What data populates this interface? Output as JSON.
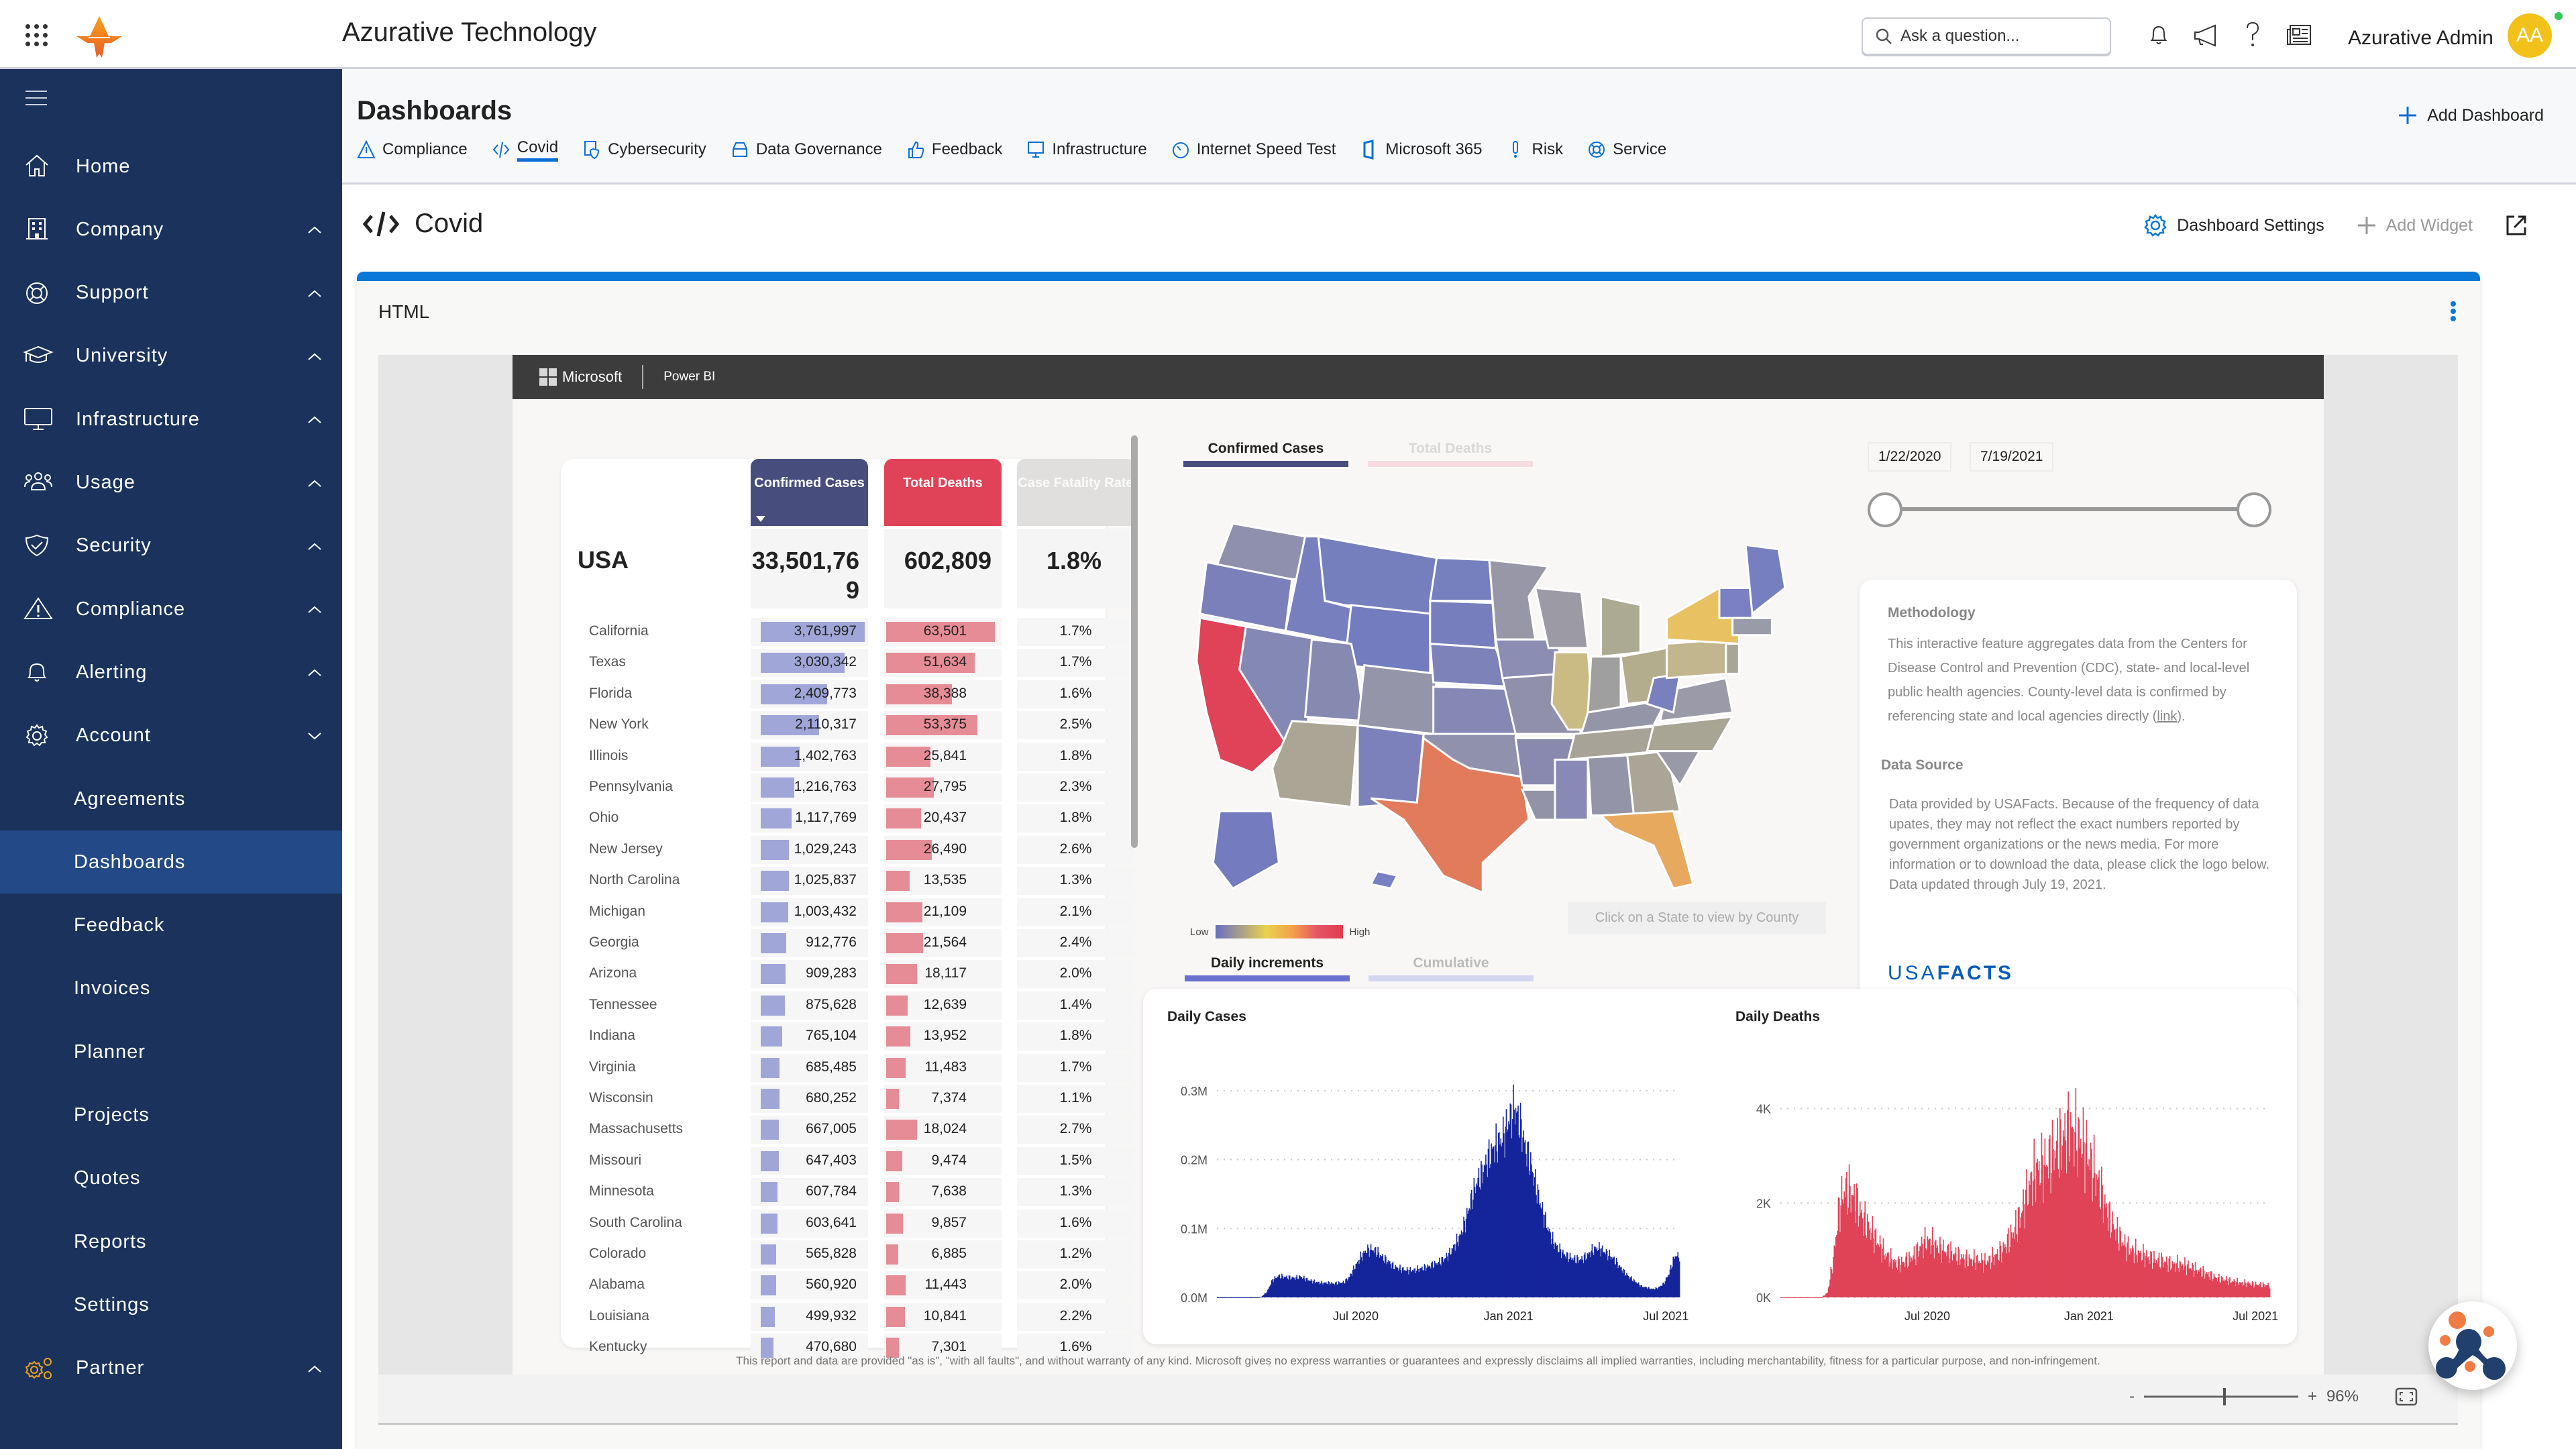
{
  "app": {
    "title": "Azurative Technology",
    "search_placeholder": "Ask a question...",
    "user_name": "Azurative Admin",
    "user_initials": "AA"
  },
  "sidebar": {
    "items": [
      {
        "label": "Home",
        "icon": "home-icon",
        "chevron": ""
      },
      {
        "label": "Company",
        "icon": "building-icon",
        "chevron": "up"
      },
      {
        "label": "Support",
        "icon": "lifebuoy-icon",
        "chevron": "up"
      },
      {
        "label": "University",
        "icon": "graduation-cap-icon",
        "chevron": "up"
      },
      {
        "label": "Infrastructure",
        "icon": "monitor-icon",
        "chevron": "up"
      },
      {
        "label": "Usage",
        "icon": "people-icon",
        "chevron": "up"
      },
      {
        "label": "Security",
        "icon": "shield-check-icon",
        "chevron": "up"
      },
      {
        "label": "Compliance",
        "icon": "warning-icon",
        "chevron": "up"
      },
      {
        "label": "Alerting",
        "icon": "bell-icon",
        "chevron": "up"
      },
      {
        "label": "Account",
        "icon": "gear-icon",
        "chevron": "down"
      }
    ],
    "sub_items": [
      "Agreements",
      "Dashboards",
      "Feedback",
      "Invoices",
      "Planner",
      "Projects",
      "Quotes",
      "Reports",
      "Settings"
    ],
    "active_sub": "Dashboards",
    "partner": {
      "label": "Partner",
      "icon": "gears-icon",
      "chevron": "up"
    }
  },
  "dashboards": {
    "title": "Dashboards",
    "add_label": "Add Dashboard",
    "tabs": [
      {
        "label": "Compliance",
        "icon": "warning-icon"
      },
      {
        "label": "Covid",
        "icon": "code-icon",
        "active": true
      },
      {
        "label": "Cybersecurity",
        "icon": "shield-doc-icon"
      },
      {
        "label": "Data Governance",
        "icon": "drive-icon"
      },
      {
        "label": "Feedback",
        "icon": "thumbs-up-icon"
      },
      {
        "label": "Infrastructure",
        "icon": "monitor-icon"
      },
      {
        "label": "Internet Speed Test",
        "icon": "speedometer-icon"
      },
      {
        "label": "Microsoft 365",
        "icon": "office-icon"
      },
      {
        "label": "Risk",
        "icon": "exclamation-icon"
      },
      {
        "label": "Service",
        "icon": "lifebuoy-icon"
      }
    ]
  },
  "page": {
    "title": "Covid",
    "settings_label": "Dashboard Settings",
    "add_widget_label": "Add Widget",
    "widget_title": "HTML"
  },
  "powerbi": {
    "brand": "Microsoft",
    "product": "Power BI",
    "headers": {
      "confirmed": "Confirmed Cases",
      "deaths": "Total Deaths",
      "cfr": "Case Fatality Rate"
    },
    "usa": {
      "label": "USA",
      "confirmed": "33,501,769",
      "deaths": "602,809",
      "cfr": "1.8%"
    },
    "states": [
      {
        "name": "California",
        "confirmed": "3,761,997",
        "deaths": "63,501",
        "cfr": "1.7%",
        "c": 3761997,
        "d": 63501
      },
      {
        "name": "Texas",
        "confirmed": "3,030,342",
        "deaths": "51,634",
        "cfr": "1.7%",
        "c": 3030342,
        "d": 51634
      },
      {
        "name": "Florida",
        "confirmed": "2,409,773",
        "deaths": "38,388",
        "cfr": "1.6%",
        "c": 2409773,
        "d": 38388
      },
      {
        "name": "New York",
        "confirmed": "2,110,317",
        "deaths": "53,375",
        "cfr": "2.5%",
        "c": 2110317,
        "d": 53375
      },
      {
        "name": "Illinois",
        "confirmed": "1,402,763",
        "deaths": "25,841",
        "cfr": "1.8%",
        "c": 1402763,
        "d": 25841
      },
      {
        "name": "Pennsylvania",
        "confirmed": "1,216,763",
        "deaths": "27,795",
        "cfr": "2.3%",
        "c": 1216763,
        "d": 27795
      },
      {
        "name": "Ohio",
        "confirmed": "1,117,769",
        "deaths": "20,437",
        "cfr": "1.8%",
        "c": 1117769,
        "d": 20437
      },
      {
        "name": "New Jersey",
        "confirmed": "1,029,243",
        "deaths": "26,490",
        "cfr": "2.6%",
        "c": 1029243,
        "d": 26490
      },
      {
        "name": "North Carolina",
        "confirmed": "1,025,837",
        "deaths": "13,535",
        "cfr": "1.3%",
        "c": 1025837,
        "d": 13535
      },
      {
        "name": "Michigan",
        "confirmed": "1,003,432",
        "deaths": "21,109",
        "cfr": "2.1%",
        "c": 1003432,
        "d": 21109
      },
      {
        "name": "Georgia",
        "confirmed": "912,776",
        "deaths": "21,564",
        "cfr": "2.4%",
        "c": 912776,
        "d": 21564
      },
      {
        "name": "Arizona",
        "confirmed": "909,283",
        "deaths": "18,117",
        "cfr": "2.0%",
        "c": 909283,
        "d": 18117
      },
      {
        "name": "Tennessee",
        "confirmed": "875,628",
        "deaths": "12,639",
        "cfr": "1.4%",
        "c": 875628,
        "d": 12639
      },
      {
        "name": "Indiana",
        "confirmed": "765,104",
        "deaths": "13,952",
        "cfr": "1.8%",
        "c": 765104,
        "d": 13952
      },
      {
        "name": "Virginia",
        "confirmed": "685,485",
        "deaths": "11,483",
        "cfr": "1.7%",
        "c": 685485,
        "d": 11483
      },
      {
        "name": "Wisconsin",
        "confirmed": "680,252",
        "deaths": "7,374",
        "cfr": "1.1%",
        "c": 680252,
        "d": 7374
      },
      {
        "name": "Massachusetts",
        "confirmed": "667,005",
        "deaths": "18,024",
        "cfr": "2.7%",
        "c": 667005,
        "d": 18024
      },
      {
        "name": "Missouri",
        "confirmed": "647,403",
        "deaths": "9,474",
        "cfr": "1.5%",
        "c": 647403,
        "d": 9474
      },
      {
        "name": "Minnesota",
        "confirmed": "607,784",
        "deaths": "7,638",
        "cfr": "1.3%",
        "c": 607784,
        "d": 7638
      },
      {
        "name": "South Carolina",
        "confirmed": "603,641",
        "deaths": "9,857",
        "cfr": "1.6%",
        "c": 603641,
        "d": 9857
      },
      {
        "name": "Colorado",
        "confirmed": "565,828",
        "deaths": "6,885",
        "cfr": "1.2%",
        "c": 565828,
        "d": 6885
      },
      {
        "name": "Alabama",
        "confirmed": "560,920",
        "deaths": "11,443",
        "cfr": "2.0%",
        "c": 560920,
        "d": 11443
      },
      {
        "name": "Louisiana",
        "confirmed": "499,932",
        "deaths": "10,841",
        "cfr": "2.2%",
        "c": 499932,
        "d": 10841
      },
      {
        "name": "Kentucky",
        "confirmed": "470,680",
        "deaths": "7,301",
        "cfr": "1.6%",
        "c": 470680,
        "d": 7301
      }
    ],
    "map_tabs": [
      "Confirmed Cases",
      "Total Deaths"
    ],
    "legend": {
      "low": "Low",
      "high": "High"
    },
    "click_hint": "Click on a State to view by County",
    "date_start": "1/22/2020",
    "date_end": "7/19/2021",
    "methodology_title": "Methodology",
    "methodology_text": "This interactive feature aggregates data from the Centers for Disease Control and Prevention (CDC), state- and local-level public health agencies. County-level data is confirmed by referencing state and local agencies directly (",
    "methodology_link": "link",
    "methodology_end": ").",
    "source_title": "Data Source",
    "source_text": "Data provided by USAFacts. Because of the frequency of data upates, they may not reflect the exact numbers reported by government organizations or the news media. For more information or to download the data, please click the logo below. Data updated through July 19, 2021.",
    "usafacts_a": "USA",
    "usafacts_b": "FACTS",
    "chart_tabs": [
      "Daily increments",
      "Cumulative"
    ],
    "disclaimer": "This report and data are provided \"as is\", \"with all faults\", and without warranty of any kind. Microsoft gives no express warranties or guarantees and expressly disclaims all implied warranties, including merchantability, fitness for a particular purpose, and non-infringement.",
    "zoom_level": "96%"
  },
  "colors": {
    "sidebar": "#1a325c",
    "accent": "#0a78d6",
    "cases": "#14249b",
    "deaths": "#e04257"
  },
  "chart_data": [
    {
      "type": "bar",
      "title": "Daily Cases",
      "xlabel": "",
      "ylabel": "",
      "x_ticks": [
        "Jul 2020",
        "Jan 2021",
        "Jul 2021"
      ],
      "y_ticks": [
        "0.0M",
        "0.1M",
        "0.2M",
        "0.3M"
      ],
      "ylim": [
        0,
        370000
      ],
      "x_range": [
        "2020-01-22",
        "2021-07-19"
      ],
      "series": [
        {
          "name": "Daily Cases",
          "color": "#14249b",
          "weekly_values": [
            0,
            0,
            0,
            0,
            0,
            0,
            0,
            0,
            1000,
            8000,
            25000,
            31000,
            30000,
            29000,
            28000,
            30000,
            27000,
            24000,
            22000,
            21000,
            21000,
            20000,
            21000,
            22000,
            30000,
            45000,
            58000,
            68000,
            70000,
            66000,
            58000,
            52000,
            45000,
            42000,
            40000,
            39000,
            40000,
            42000,
            44000,
            47000,
            50000,
            55000,
            62000,
            75000,
            88000,
            110000,
            140000,
            165000,
            180000,
            200000,
            215000,
            225000,
            235000,
            260000,
            275000,
            250000,
            215000,
            190000,
            155000,
            125000,
            100000,
            80000,
            70000,
            62000,
            58000,
            55000,
            55000,
            60000,
            68000,
            72000,
            68000,
            62000,
            55000,
            45000,
            35000,
            28000,
            22000,
            16000,
            14000,
            12000,
            14000,
            20000,
            35000,
            60000
          ]
        }
      ]
    },
    {
      "type": "bar",
      "title": "Daily Deaths",
      "xlabel": "",
      "ylabel": "",
      "x_ticks": [
        "Jul 2020",
        "Jan 2021",
        "Jul 2021"
      ],
      "y_ticks": [
        "0K",
        "2K",
        "4K"
      ],
      "ylim": [
        0,
        5400
      ],
      "x_range": [
        "2020-01-22",
        "2021-07-19"
      ],
      "series": [
        {
          "name": "Daily Deaths",
          "color": "#e04257",
          "weekly_values": [
            0,
            0,
            0,
            0,
            0,
            0,
            0,
            0,
            100,
            800,
            1900,
            2300,
            2200,
            2000,
            1700,
            1500,
            1300,
            1100,
            900,
            800,
            700,
            750,
            800,
            900,
            1100,
            1200,
            1150,
            1050,
            1000,
            950,
            900,
            850,
            800,
            800,
            780,
            750,
            800,
            900,
            1000,
            1200,
            1400,
            1700,
            2100,
            2500,
            2700,
            2800,
            2900,
            3100,
            3300,
            3500,
            3500,
            3400,
            3200,
            2900,
            2600,
            2200,
            1800,
            1500,
            1300,
            1100,
            1000,
            950,
            900,
            850,
            800,
            780,
            750,
            700,
            700,
            680,
            650,
            600,
            550,
            500,
            450,
            400,
            380,
            350,
            330,
            300,
            300,
            280,
            270,
            260
          ]
        }
      ]
    }
  ]
}
